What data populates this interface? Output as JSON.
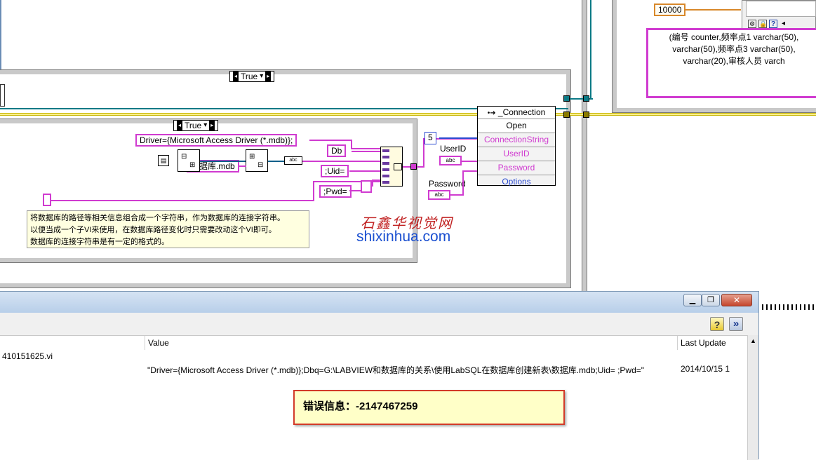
{
  "diagram": {
    "outer_case_label": "True",
    "inner_case_label": "True",
    "driver_string": "Driver={Microsoft Access Driver (*.mdb)};",
    "db_string": "Db",
    "uid_string": ";Uid=",
    "pwd_string": ";Pwd=",
    "mdb_filename": "数据库.mdb",
    "constant_5": "5",
    "constant_10000": "10000",
    "userid_label": "UserID",
    "password_label": "Password",
    "abc_label": "abc",
    "connection_node": {
      "title": "_Connection",
      "rows": [
        "Open",
        "ConnectionString",
        "UserID",
        "Password",
        "Options"
      ]
    },
    "comment_lines": [
      "将数据库的路径等相关信息组合成一个字符串，作为数据库的连接字符串。",
      "以便当成一个子VI来使用，在数据库路径变化时只需要改动这个VI即可。",
      "数据库的连接字符串是有一定的格式的。"
    ],
    "sql_text_lines": [
      "(编号 counter,频率点1 varchar(50),",
      "varchar(50),频率点3 varchar(50),",
      "varchar(20),审核人员 varch"
    ]
  },
  "watermark": {
    "chinese": "石鑫华视觉网",
    "url": "shixinhua.com"
  },
  "probe_window": {
    "columns": [
      "Value",
      "Last Update"
    ],
    "row": {
      "name": "410151625.vi",
      "value": "\"Driver={Microsoft Access Driver (*.mdb)};Dbq=G:\\LABVIEW和数据库的关系\\使用LabSQL在数据库创建新表\\数据库.mdb;Uid= ;Pwd=\"",
      "last_update": "2014/10/15 1"
    },
    "help_icon": "?",
    "expand_icon": "»"
  },
  "error_message": "错误信息：-2147467259",
  "colors": {
    "string_wire": "#d03bd0",
    "refnum_wire": "#0c7a86",
    "error_wire": "#8a7a00",
    "error_border": "#d23a2a"
  }
}
